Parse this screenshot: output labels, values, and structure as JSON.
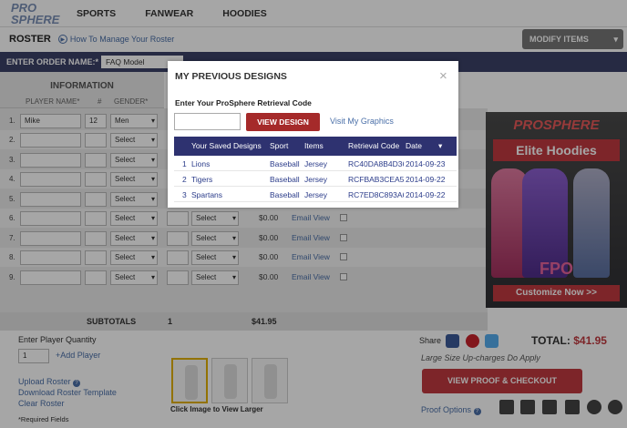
{
  "logo": {
    "text_a": "PRO",
    "text_b": "SPHERE"
  },
  "nav": [
    "SPORTS",
    "FANWEAR",
    "HOODIES"
  ],
  "roster": {
    "title": "ROSTER",
    "howto": "How To Manage Your Roster",
    "modify": "MODIFY ITEMS"
  },
  "order": {
    "label": "ENTER ORDER NAME:*",
    "value": "FAQ Model"
  },
  "table": {
    "section": "INFORMATION",
    "col_name": "PLAYER NAME*",
    "col_num": "#",
    "col_gender": "GENDER*",
    "rows": [
      {
        "n": "1.",
        "name": "Mike",
        "num": "12",
        "gender": "Men"
      },
      {
        "n": "2.",
        "name": "",
        "num": "",
        "gender": "Select"
      },
      {
        "n": "3.",
        "name": "",
        "num": "",
        "gender": "Select"
      },
      {
        "n": "4.",
        "name": "",
        "num": "",
        "gender": "Select"
      },
      {
        "n": "5.",
        "name": "",
        "num": "",
        "gender": "Select"
      },
      {
        "n": "6.",
        "name": "",
        "num": "",
        "gender": "Select",
        "size": "Select",
        "price": "$0.00",
        "email": "Email",
        "view": "View"
      },
      {
        "n": "7.",
        "name": "",
        "num": "",
        "gender": "Select",
        "size": "Select",
        "price": "$0.00",
        "email": "Email",
        "view": "View"
      },
      {
        "n": "8.",
        "name": "",
        "num": "",
        "gender": "Select",
        "size": "Select",
        "price": "$0.00",
        "email": "Email",
        "view": "View"
      },
      {
        "n": "9.",
        "name": "",
        "num": "",
        "gender": "Select",
        "size": "Select",
        "price": "$0.00",
        "email": "Email",
        "view": "View"
      }
    ],
    "subtotals_label": "SUBTOTALS",
    "subtotals_qty": "1",
    "subtotals_price": "$41.95"
  },
  "ad": {
    "brand": "PROSPHERE",
    "title": "Elite Hoodies",
    "fpo": "FPO",
    "cta": "Customize Now >>"
  },
  "bottom": {
    "qty_label": "Enter Player Quantity",
    "qty_value": "1",
    "add_player": "+Add Player",
    "upload": "Upload Roster",
    "download": "Download Roster Template",
    "clear": "Clear Roster",
    "required": "*Required Fields",
    "thumbs_caption": "Click Image to View Larger",
    "share": "Share",
    "total_label": "TOTAL:",
    "total_value": "$41.95",
    "note": "Large Size Up-charges Do Apply",
    "proof_button": "VIEW PROOF & CHECKOUT",
    "proof_options": "Proof Options"
  },
  "colors": {
    "brand_red": "#c0393f",
    "navy": "#2e3270",
    "order_bar": "#3b4168",
    "link": "#4a6fa8"
  },
  "modal": {
    "title": "MY PREVIOUS DESIGNS",
    "close": "×",
    "label": "Enter Your ProSphere Retrieval Code",
    "code_value": "",
    "view_button": "VIEW DESIGN",
    "graphics_link": "Visit My Graphics",
    "headers": {
      "designs": "Your Saved Designs",
      "sport": "Sport",
      "items": "Items",
      "code": "Retrieval Code",
      "date": "Date"
    },
    "rows": [
      {
        "n": "1",
        "name": "Lions",
        "sport": "Baseball",
        "items": "Jersey",
        "code": "RC40DA8B4D36",
        "date": "2014-09-23"
      },
      {
        "n": "2",
        "name": "Tigers",
        "sport": "Baseball",
        "items": "Jersey",
        "code": "RCFBAB3CEA5E",
        "date": "2014-09-22"
      },
      {
        "n": "3",
        "name": "Spartans",
        "sport": "Baseball",
        "items": "Jersey",
        "code": "RC7ED8C893A6",
        "date": "2014-09-22"
      }
    ]
  }
}
